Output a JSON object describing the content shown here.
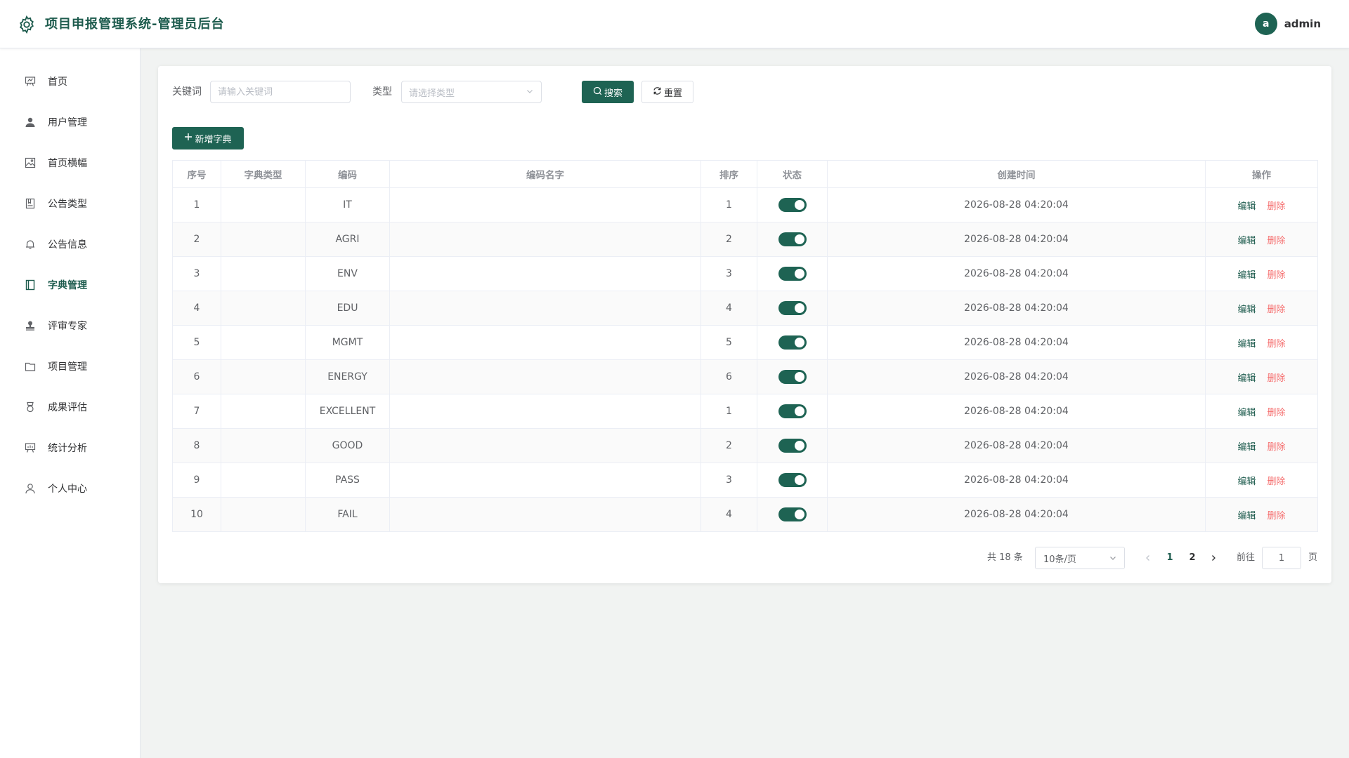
{
  "header": {
    "title": "项目申报管理系统-管理员后台",
    "avatar_letter": "a",
    "username": "admin"
  },
  "sidebar": {
    "items": [
      {
        "label": "首页",
        "icon": "presentation-board-icon"
      },
      {
        "label": "用户管理",
        "icon": "user-filled-icon"
      },
      {
        "label": "首页横幅",
        "icon": "picture-icon"
      },
      {
        "label": "公告类型",
        "icon": "notebook-icon"
      },
      {
        "label": "公告信息",
        "icon": "bell-icon"
      },
      {
        "label": "字典管理",
        "icon": "book-icon",
        "active": true
      },
      {
        "label": "评审专家",
        "icon": "stamp-icon"
      },
      {
        "label": "项目管理",
        "icon": "folder-icon"
      },
      {
        "label": "成果评估",
        "icon": "medal-icon"
      },
      {
        "label": "统计分析",
        "icon": "data-board-icon"
      },
      {
        "label": "个人中心",
        "icon": "user-outline-icon"
      }
    ]
  },
  "search": {
    "keyword_label": "关键词",
    "keyword_placeholder": "请输入关键词",
    "type_label": "类型",
    "type_placeholder": "请选择类型",
    "search_button": "搜索",
    "reset_button": "重置"
  },
  "toolbar": {
    "add_button": "新增字典"
  },
  "table": {
    "columns": [
      "序号",
      "字典类型",
      "编码",
      "编码名字",
      "排序",
      "状态",
      "创建时间",
      "操作"
    ],
    "rows": [
      {
        "index": "1",
        "dict_type": "",
        "code": "IT",
        "code_name": "",
        "sort": "1",
        "enabled": true,
        "created": "2026-08-28 04:20:04"
      },
      {
        "index": "2",
        "dict_type": "",
        "code": "AGRI",
        "code_name": "",
        "sort": "2",
        "enabled": true,
        "created": "2026-08-28 04:20:04"
      },
      {
        "index": "3",
        "dict_type": "",
        "code": "ENV",
        "code_name": "",
        "sort": "3",
        "enabled": true,
        "created": "2026-08-28 04:20:04"
      },
      {
        "index": "4",
        "dict_type": "",
        "code": "EDU",
        "code_name": "",
        "sort": "4",
        "enabled": true,
        "created": "2026-08-28 04:20:04"
      },
      {
        "index": "5",
        "dict_type": "",
        "code": "MGMT",
        "code_name": "",
        "sort": "5",
        "enabled": true,
        "created": "2026-08-28 04:20:04"
      },
      {
        "index": "6",
        "dict_type": "",
        "code": "ENERGY",
        "code_name": "",
        "sort": "6",
        "enabled": true,
        "created": "2026-08-28 04:20:04"
      },
      {
        "index": "7",
        "dict_type": "",
        "code": "EXCELLENT",
        "code_name": "",
        "sort": "1",
        "enabled": true,
        "created": "2026-08-28 04:20:04"
      },
      {
        "index": "8",
        "dict_type": "",
        "code": "GOOD",
        "code_name": "",
        "sort": "2",
        "enabled": true,
        "created": "2026-08-28 04:20:04"
      },
      {
        "index": "9",
        "dict_type": "",
        "code": "PASS",
        "code_name": "",
        "sort": "3",
        "enabled": true,
        "created": "2026-08-28 04:20:04"
      },
      {
        "index": "10",
        "dict_type": "",
        "code": "FAIL",
        "code_name": "",
        "sort": "4",
        "enabled": true,
        "created": "2026-08-28 04:20:04"
      }
    ],
    "edit_label": "编辑",
    "delete_label": "删除"
  },
  "pagination": {
    "total_text": "共 18 条",
    "page_size": "10条/页",
    "pages": [
      "1",
      "2"
    ],
    "current_page": "1",
    "goto_label": "前往",
    "goto_value": "1",
    "page_suffix": "页"
  },
  "colors": {
    "primary": "#1e6353",
    "danger": "#f56c6c",
    "background": "#f1f3f2"
  }
}
